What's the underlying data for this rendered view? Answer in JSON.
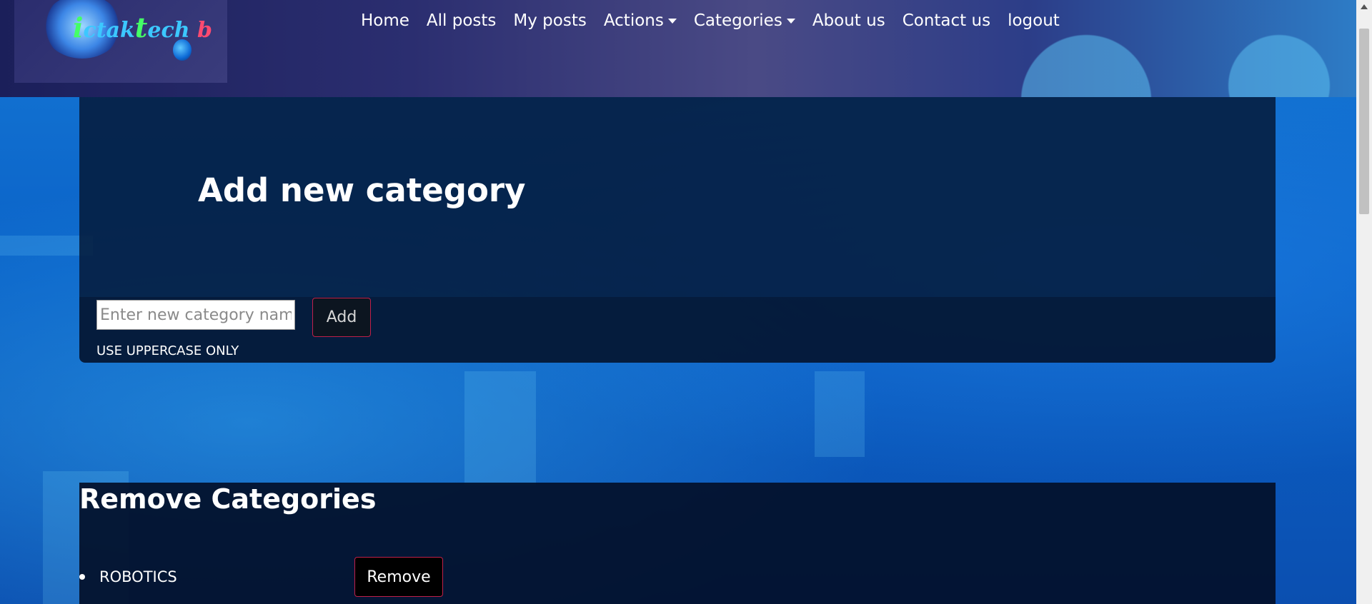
{
  "header": {
    "logo_text_a": "i",
    "logo_text_b": "ctak",
    "logo_text_c": "t",
    "logo_text_d": "ech ",
    "logo_text_e": "b",
    "nav": [
      {
        "label": "Home",
        "dropdown": false
      },
      {
        "label": "All posts",
        "dropdown": false
      },
      {
        "label": "My posts",
        "dropdown": false
      },
      {
        "label": "Actions",
        "dropdown": true
      },
      {
        "label": "Categories",
        "dropdown": true
      },
      {
        "label": "About us",
        "dropdown": false
      },
      {
        "label": "Contact us",
        "dropdown": false
      },
      {
        "label": "logout",
        "dropdown": false
      }
    ]
  },
  "add_category": {
    "title": "Add new category",
    "input_placeholder": "Enter new category name",
    "input_value": "",
    "add_label": "Add",
    "hint": "USE UPPERCASE ONLY"
  },
  "remove_categories": {
    "title": "Remove Categories",
    "items": [
      {
        "name": "ROBOTICS",
        "button_label": "Remove"
      }
    ]
  },
  "colors": {
    "accent_border": "#c0204a",
    "panel": "#041b3c"
  }
}
